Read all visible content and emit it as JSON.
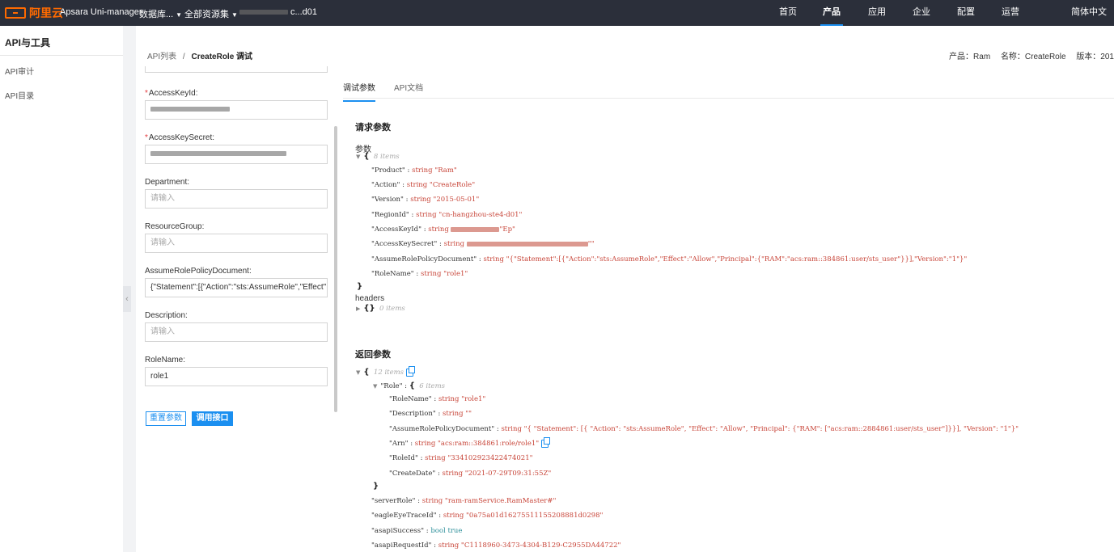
{
  "topbar": {
    "brand": "阿里云",
    "product_name": "Apsara Uni-manager",
    "dropdown_1": "数据库...",
    "dropdown_2": "全部资源集",
    "region": "c...d01",
    "nav": [
      "首页",
      "产品",
      "应用",
      "企业",
      "配置",
      "运营"
    ],
    "active_nav": "产品",
    "language": "简体中文"
  },
  "sidebar": {
    "title": "API与工具",
    "items": [
      "API审计",
      "API目录"
    ]
  },
  "breadcrumb": {
    "parent": "API列表",
    "sep": "/",
    "current": "CreateRole 调试"
  },
  "meta": {
    "product": "产品：Ram",
    "name": "名称：CreateRole",
    "version": "版本：201"
  },
  "form": {
    "fields": [
      {
        "label": "AccessKeyId:",
        "required": true,
        "value": "",
        "placeholder": ""
      },
      {
        "label": "AccessKeySecret:",
        "required": true,
        "value": "",
        "placeholder": ""
      },
      {
        "label": "Department:",
        "required": false,
        "value": "",
        "placeholder": "请输入"
      },
      {
        "label": "ResourceGroup:",
        "required": false,
        "value": "",
        "placeholder": "请输入"
      },
      {
        "label": "AssumeRolePolicyDocument:",
        "required": false,
        "value": "{\"Statement\":[{\"Action\":\"sts:AssumeRole\",\"Effect\":\"Al",
        "placeholder": ""
      },
      {
        "label": "Description:",
        "required": false,
        "value": "",
        "placeholder": "请输入"
      },
      {
        "label": "RoleName:",
        "required": false,
        "value": "role1",
        "placeholder": ""
      }
    ],
    "reset_label": "重置参数",
    "call_label": "调用接口"
  },
  "tabs": [
    "调试参数",
    "API文档"
  ],
  "request": {
    "title": "请求参数",
    "params_label": "参数",
    "items_count": "8 items",
    "entries": [
      {
        "key": "\"Product\"",
        "type": "string",
        "value": "\"Ram\""
      },
      {
        "key": "\"Action\"",
        "type": "string",
        "value": "\"CreateRole\""
      },
      {
        "key": "\"Version\"",
        "type": "string",
        "value": "\"2015-05-01\""
      },
      {
        "key": "\"RegionId\"",
        "type": "string",
        "value": "\"cn-hangzhou-ste4-d01\""
      },
      {
        "key": "\"AccessKeyId\"",
        "type": "string",
        "value": "\"Ep\""
      },
      {
        "key": "\"AccessKeySecret\"",
        "type": "string",
        "value": "\"\""
      },
      {
        "key": "\"AssumeRolePolicyDocument\"",
        "type": "string",
        "value": "\"{\"Statement\":[{\"Action\":\"sts:AssumeRole\",\"Effect\":\"Allow\",\"Principal\":{\"RAM\":\"acs:ram::384861:user/sts_user\"}}],\"Version\":\"1\"}\""
      },
      {
        "key": "\"RoleName\"",
        "type": "string",
        "value": "\"role1\""
      }
    ],
    "headers_label": "headers",
    "headers_count": "0 items"
  },
  "response": {
    "title": "返回参数",
    "items_count": "12 items",
    "role_key": "\"Role\"",
    "role_count": "6 items",
    "role_entries": [
      {
        "key": "\"RoleName\"",
        "type": "string",
        "value": "\"role1\""
      },
      {
        "key": "\"Description\"",
        "type": "string",
        "value": "\"\""
      },
      {
        "key": "\"AssumeRolePolicyDocument\"",
        "type": "string",
        "value": "\"{ \"Statement\": [{ \"Action\": \"sts:AssumeRole\", \"Effect\": \"Allow\", \"Principal\": {\"RAM\": [\"acs:ram::2884861:user/sts_user\"]}}], \"Version\": \"1\"}\""
      },
      {
        "key": "\"Arn\"",
        "type": "string",
        "value": "\"acs:ram::384861:role/role1\""
      },
      {
        "key": "\"RoleId\"",
        "type": "string",
        "value": "\"334102923422474021\""
      },
      {
        "key": "\"CreateDate\"",
        "type": "string",
        "value": "\"2021-07-29T09:31:55Z\""
      }
    ],
    "entries": [
      {
        "key": "\"serverRole\"",
        "type": "string",
        "value": "\"ram-ramService.RamMaster#\""
      },
      {
        "key": "\"eagleEyeTraceId\"",
        "type": "string",
        "value": "\"0a75a01d16275511155208881d0298\""
      },
      {
        "key": "\"asapiSuccess\"",
        "type": "bool",
        "value": "true"
      },
      {
        "key": "\"asapiRequestId\"",
        "type": "string",
        "value": "\"C1118960-3473-4304-B129-C2955DA44722\""
      }
    ]
  }
}
